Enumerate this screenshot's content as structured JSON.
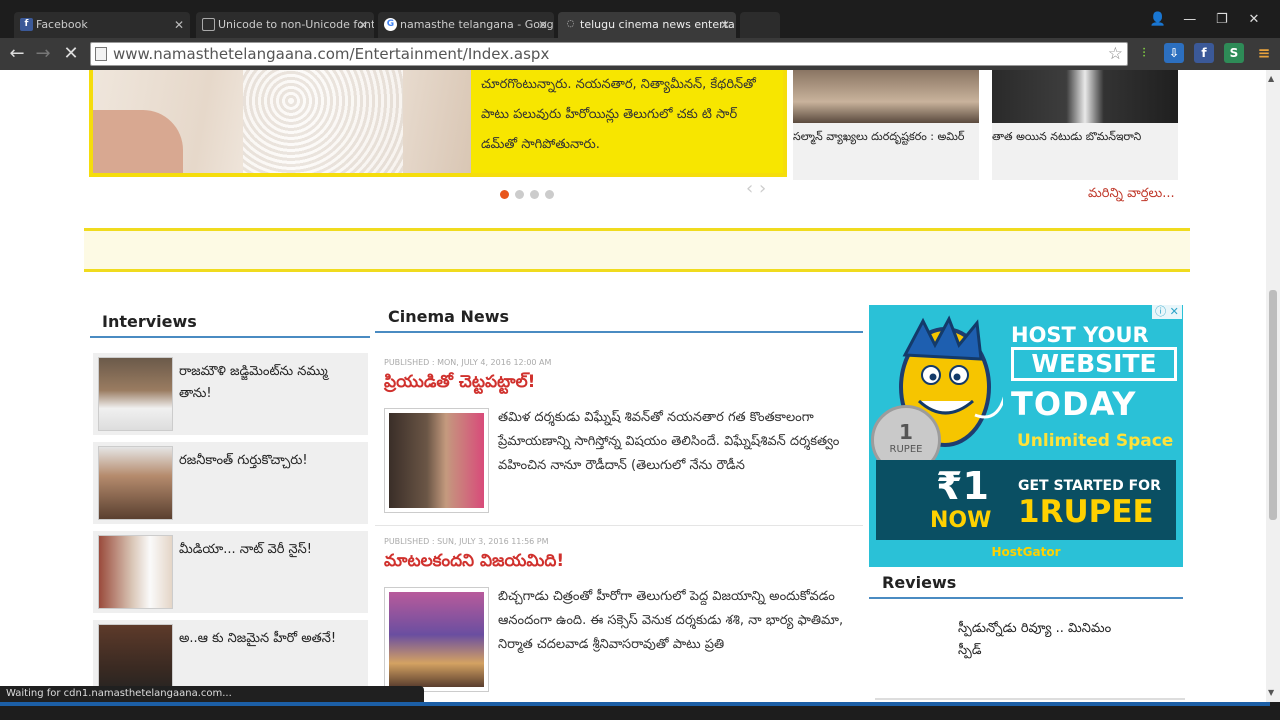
{
  "browser": {
    "tabs": [
      {
        "label": "Facebook",
        "icon": "facebook-icon",
        "color": "#3b5998",
        "glyph": "f"
      },
      {
        "label": "Unicode to non-Unicode font",
        "icon": "page-icon",
        "color": "#444444",
        "glyph": ""
      },
      {
        "label": "namasthe telangana - Googl",
        "icon": "google-icon",
        "color": "#ffffff",
        "glyph": "G"
      },
      {
        "label": "telugu cinema news enterta",
        "icon": "loading-icon",
        "color": "#2c2c2c",
        "glyph": "C"
      }
    ],
    "url": "www.namasthetelangaana.com/Entertainment/Index.aspx",
    "status": "Waiting for cdn1.namasthetelangaana.com..."
  },
  "slider": {
    "text": "చూరగొంటున్నారు. నయనతార, నిత్యామీనన్, కేథరిన్‌తో పాటు పలువురు హీరోయిన్లు తెలుగులో చకు టి సార్ డమ్‌తో సాగిపోతునారు.",
    "thumbs": [
      {
        "caption": "సల్మాన్ వ్యాఖ్యలు దురదృష్టకరం : అమిర్"
      },
      {
        "caption": "తాత అయిన నటుడు బొమన్ఇరాని"
      }
    ],
    "more_link": "మరిన్ని వార్తలు..."
  },
  "interviews": {
    "heading": "Interviews",
    "items": [
      {
        "title": "రాజమౌళి జడ్జిమెంట్‌ను నమ్ము తాను!"
      },
      {
        "title": "రజనీకాంత్ గుర్తుకొచ్చారు!"
      },
      {
        "title": "మీడియా... నాట్ వెరీ నైస్!"
      },
      {
        "title": "అ..ఆ కు నిజమైన హీరో అతనే!"
      }
    ]
  },
  "cinema_news": {
    "heading": "Cinema News",
    "items": [
      {
        "meta": "PUBLISHED : MON, JULY 4, 2016 12:00 AM",
        "title": "ప్రియుడితో చెట్టపట్టాల్!",
        "body": "తమిళ దర్శకుడు విఘ్నేష్ శివన్‌తో నయనతార గత కొంతకాలంగా ప్రేమాయణాన్ని సాగిస్తోన్న విషయం తెలిసిందే. విఘ్నేష్‌శివన్ దర్శకత్వం వహించిన నానూ రౌడీదాన్ (తెలుగులో నేను రౌడీన"
      },
      {
        "meta": "PUBLISHED : SUN, JULY 3, 2016 11:56 PM",
        "title": "మాటలకందని విజయమిది!",
        "body": "బిచ్చగాడు చిత్రంతో హీరోగా తెలుగులో పెద్ద విజయాన్ని అందుకోవడం ఆనందంగా ఉంది. ఈ సక్సెస్ వెనుక దర్శకుడు శశి, నా భార్య ఫాతిమా, నిర్మాత చదలవాడ శ్రీనివాసరావుతో పాటు ప్రతి"
      }
    ]
  },
  "ad": {
    "line1": "HOST YOUR",
    "line2": "WEBSITE",
    "line3": "TODAY",
    "line4": "Unlimited Space",
    "rupee": "₹1",
    "now": "NOW",
    "get": "GET STARTED FOR",
    "one": "1RUPEE",
    "brand": "HostGator",
    "coin_top": "1",
    "coin_bottom": "RUPEE"
  },
  "reviews": {
    "heading": "Reviews",
    "item": "స్పీడున్నోడు రివ్యూ .. మినిమం స్పీడ్"
  },
  "colors": {
    "accent_yellow": "#f5dd0c",
    "link_red": "#d0312d",
    "section_blue": "#4a8bc2"
  }
}
